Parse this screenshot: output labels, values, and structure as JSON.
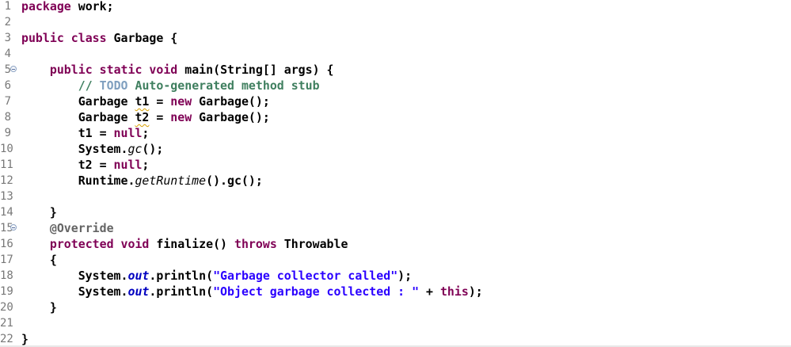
{
  "editor": {
    "lines": [
      {
        "n": "1",
        "tokens": [
          {
            "c": "kw",
            "t": "package"
          },
          {
            "c": "",
            "t": " work;"
          }
        ]
      },
      {
        "n": "2",
        "tokens": []
      },
      {
        "n": "3",
        "tokens": [
          {
            "c": "kw",
            "t": "public"
          },
          {
            "c": "",
            "t": " "
          },
          {
            "c": "kw",
            "t": "class"
          },
          {
            "c": "",
            "t": " Garbage {"
          }
        ]
      },
      {
        "n": "4",
        "tokens": []
      },
      {
        "n": "5",
        "fold": true,
        "tokens": [
          {
            "c": "",
            "t": "    "
          },
          {
            "c": "kw",
            "t": "public"
          },
          {
            "c": "",
            "t": " "
          },
          {
            "c": "kw",
            "t": "static"
          },
          {
            "c": "",
            "t": " "
          },
          {
            "c": "kw",
            "t": "void"
          },
          {
            "c": "",
            "t": " main(String[] args) {"
          }
        ]
      },
      {
        "n": "6",
        "tokens": [
          {
            "c": "",
            "t": "        "
          },
          {
            "c": "cm",
            "t": "// "
          },
          {
            "c": "todo",
            "t": "TODO"
          },
          {
            "c": "cm",
            "t": " Auto-generated method stub"
          }
        ]
      },
      {
        "n": "7",
        "tokens": [
          {
            "c": "",
            "t": "        Garbage "
          },
          {
            "c": "squig",
            "t": "t1"
          },
          {
            "c": "",
            "t": " = "
          },
          {
            "c": "kw",
            "t": "new"
          },
          {
            "c": "",
            "t": " Garbage();"
          }
        ]
      },
      {
        "n": "8",
        "tokens": [
          {
            "c": "",
            "t": "        Garbage "
          },
          {
            "c": "squig",
            "t": "t2"
          },
          {
            "c": "",
            "t": " = "
          },
          {
            "c": "kw",
            "t": "new"
          },
          {
            "c": "",
            "t": " Garbage();"
          }
        ]
      },
      {
        "n": "9",
        "tokens": [
          {
            "c": "",
            "t": "        t1 = "
          },
          {
            "c": "kw",
            "t": "null"
          },
          {
            "c": "",
            "t": ";"
          }
        ]
      },
      {
        "n": "10",
        "tokens": [
          {
            "c": "",
            "t": "        System."
          },
          {
            "c": "sm",
            "t": "gc"
          },
          {
            "c": "",
            "t": "();"
          }
        ]
      },
      {
        "n": "11",
        "tokens": [
          {
            "c": "",
            "t": "        t2 = "
          },
          {
            "c": "kw",
            "t": "null"
          },
          {
            "c": "",
            "t": ";"
          }
        ]
      },
      {
        "n": "12",
        "tokens": [
          {
            "c": "",
            "t": "        Runtime."
          },
          {
            "c": "sm",
            "t": "getRuntime"
          },
          {
            "c": "",
            "t": "().gc();"
          }
        ]
      },
      {
        "n": "13",
        "tokens": []
      },
      {
        "n": "14",
        "tokens": [
          {
            "c": "",
            "t": "    }"
          }
        ]
      },
      {
        "n": "15",
        "fold": true,
        "tokens": [
          {
            "c": "",
            "t": "    "
          },
          {
            "c": "an",
            "t": "@Override"
          }
        ]
      },
      {
        "n": "16",
        "tokens": [
          {
            "c": "",
            "t": "    "
          },
          {
            "c": "kw",
            "t": "protected"
          },
          {
            "c": "",
            "t": " "
          },
          {
            "c": "kw",
            "t": "void"
          },
          {
            "c": "",
            "t": " finalize() "
          },
          {
            "c": "kw",
            "t": "throws"
          },
          {
            "c": "",
            "t": " Throwable"
          }
        ]
      },
      {
        "n": "17",
        "tokens": [
          {
            "c": "",
            "t": "    {"
          }
        ]
      },
      {
        "n": "18",
        "tokens": [
          {
            "c": "",
            "t": "        System."
          },
          {
            "c": "fd",
            "t": "out"
          },
          {
            "c": "",
            "t": ".println("
          },
          {
            "c": "st",
            "t": "\"Garbage collector called\""
          },
          {
            "c": "",
            "t": ");"
          }
        ]
      },
      {
        "n": "19",
        "tokens": [
          {
            "c": "",
            "t": "        System."
          },
          {
            "c": "fd",
            "t": "out"
          },
          {
            "c": "",
            "t": ".println("
          },
          {
            "c": "st",
            "t": "\"Object garbage collected : \""
          },
          {
            "c": "",
            "t": " + "
          },
          {
            "c": "kw",
            "t": "this"
          },
          {
            "c": "",
            "t": ");"
          }
        ]
      },
      {
        "n": "20",
        "tokens": [
          {
            "c": "",
            "t": "    }"
          }
        ]
      },
      {
        "n": "21",
        "tokens": []
      },
      {
        "n": "22",
        "tokens": [
          {
            "c": "",
            "t": "}"
          }
        ]
      }
    ]
  }
}
